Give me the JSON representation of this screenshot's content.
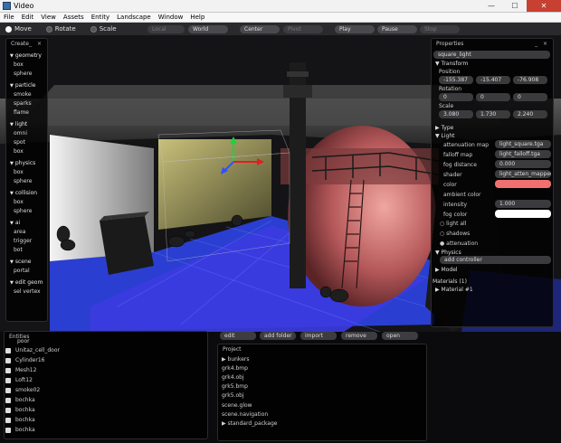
{
  "window": {
    "title": "Video",
    "minimize": "—",
    "maximize": "☐",
    "close": "✕"
  },
  "menu": [
    "File",
    "Edit",
    "View",
    "Assets",
    "Entity",
    "Landscape",
    "Window",
    "Help"
  ],
  "toolbar": {
    "modes": [
      {
        "label": "Move",
        "selected": true
      },
      {
        "label": "Rotate",
        "selected": false
      },
      {
        "label": "Scale",
        "selected": false
      }
    ],
    "local": "Local",
    "world": "World",
    "center": "Center",
    "pivot": "Pivot",
    "play": "Play",
    "pause": "Pause",
    "stop": "Stop"
  },
  "create_panel": {
    "title": "Create",
    "ctrl": "_ ×",
    "categories": [
      {
        "name": "geometry",
        "items": [
          "box",
          "sphere"
        ]
      },
      {
        "name": "particle",
        "items": [
          "smoke",
          "sparks",
          "flame"
        ]
      },
      {
        "name": "light",
        "items": [
          "omni",
          "spot",
          "box"
        ]
      },
      {
        "name": "physics",
        "items": [
          "box",
          "sphere"
        ]
      },
      {
        "name": "collision",
        "items": [
          "box",
          "sphere"
        ]
      },
      {
        "name": "ai",
        "items": [
          "area",
          "trigger",
          "bot"
        ]
      },
      {
        "name": "scene",
        "items": [
          "portal"
        ]
      },
      {
        "name": "edit geom",
        "items": [
          "sel vertex"
        ]
      }
    ]
  },
  "properties": {
    "title": "Properties",
    "ctrl": "_ ×",
    "name": "square_light",
    "transform_label": "Transform",
    "position_label": "Position",
    "position": [
      "-155.387",
      "-15.407",
      "-76.908"
    ],
    "rotation_label": "Rotation",
    "rotation": [
      "0",
      "0",
      "0"
    ],
    "scale_label": "Scale",
    "scale": [
      "3.080",
      "1.730",
      "2.240"
    ],
    "type_label": "Type",
    "light_label": "Light",
    "attenuation_map_label": "attenuation map",
    "attenuation_map": "light_square.tga",
    "falloff_map_label": "falloff map",
    "falloff_map": "light_falloff.tga",
    "fog_distance_label": "fog distance",
    "fog_distance": "0.000",
    "shader_label": "shader",
    "shader": "light_atten_mapped.p",
    "color_label": "color",
    "color_value": "#f07070",
    "ambient_color_label": "ambient color",
    "intensity_label": "intensity",
    "intensity": "1.000",
    "fog_color_label": "fog color",
    "fog_color_value": "#ffffff",
    "light_all_label": "light all",
    "shadows_label": "shadows",
    "attenuation_label": "attenuation",
    "physics_label": "Physics",
    "add_controller": "add controller",
    "model_label": "Model",
    "materials_label": "Materials (1)",
    "material_item": "Material #1"
  },
  "entities": {
    "title": "Entities",
    "items": [
      "poor",
      "Unitaz_cell_door",
      "Cylinder16",
      "Mesh12",
      "Loft12",
      "smoke02",
      "bochka",
      "bochka",
      "bochka",
      "bochka"
    ]
  },
  "project": {
    "title": "Project",
    "buttons": [
      "edit",
      "add folder",
      "import",
      "remove",
      "open"
    ],
    "items": [
      "▶ bunkers",
      "grk4.bmp",
      "grk4.obj",
      "grk5.bmp",
      "grk5.obj",
      "scene.glow",
      "scene.navigation",
      "▶ standard_package"
    ]
  }
}
